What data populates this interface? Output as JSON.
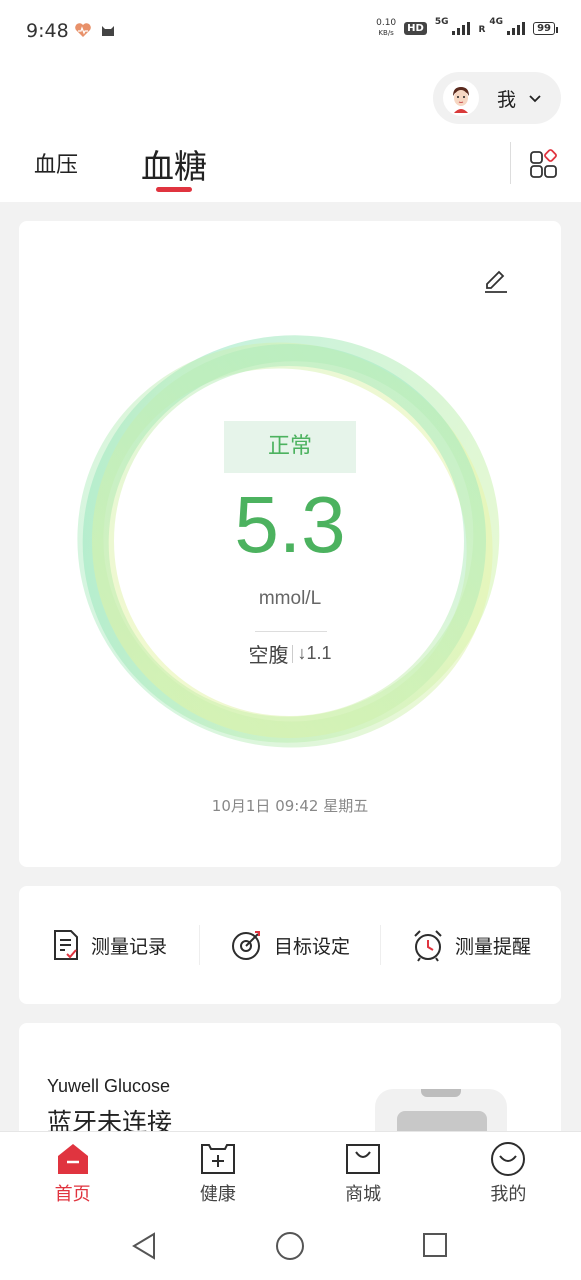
{
  "status_bar": {
    "time": "9:48",
    "net_speed_value": "0.10",
    "net_speed_unit": "KB/s",
    "hd": "HD",
    "sim1_net": "5G",
    "sim2_net": "4G",
    "roaming": "R",
    "battery": "99"
  },
  "header": {
    "profile_name": "我",
    "tabs": [
      {
        "label": "血压",
        "active": false
      },
      {
        "label": "血糖",
        "active": true
      }
    ]
  },
  "reading": {
    "status": "正常",
    "value": "5.3",
    "unit": "mmol/L",
    "meal": "空腹",
    "delta": "↓1.1",
    "timestamp": "10月1日 09:42 星期五"
  },
  "actions": [
    {
      "label": "测量记录",
      "icon": "record-icon"
    },
    {
      "label": "目标设定",
      "icon": "target-icon"
    },
    {
      "label": "测量提醒",
      "icon": "alarm-icon"
    }
  ],
  "device": {
    "name": "Yuwell Glucose",
    "status": "蓝牙未连接"
  },
  "bottom_nav": [
    {
      "label": "首页",
      "icon": "home-icon",
      "active": true
    },
    {
      "label": "健康",
      "icon": "health-icon",
      "active": false
    },
    {
      "label": "商城",
      "icon": "shop-icon",
      "active": false
    },
    {
      "label": "我的",
      "icon": "mine-icon",
      "active": false
    }
  ],
  "colors": {
    "accent": "#e0343f",
    "normal_green": "#4cb25f",
    "chip_bg": "#e6f4ea"
  }
}
